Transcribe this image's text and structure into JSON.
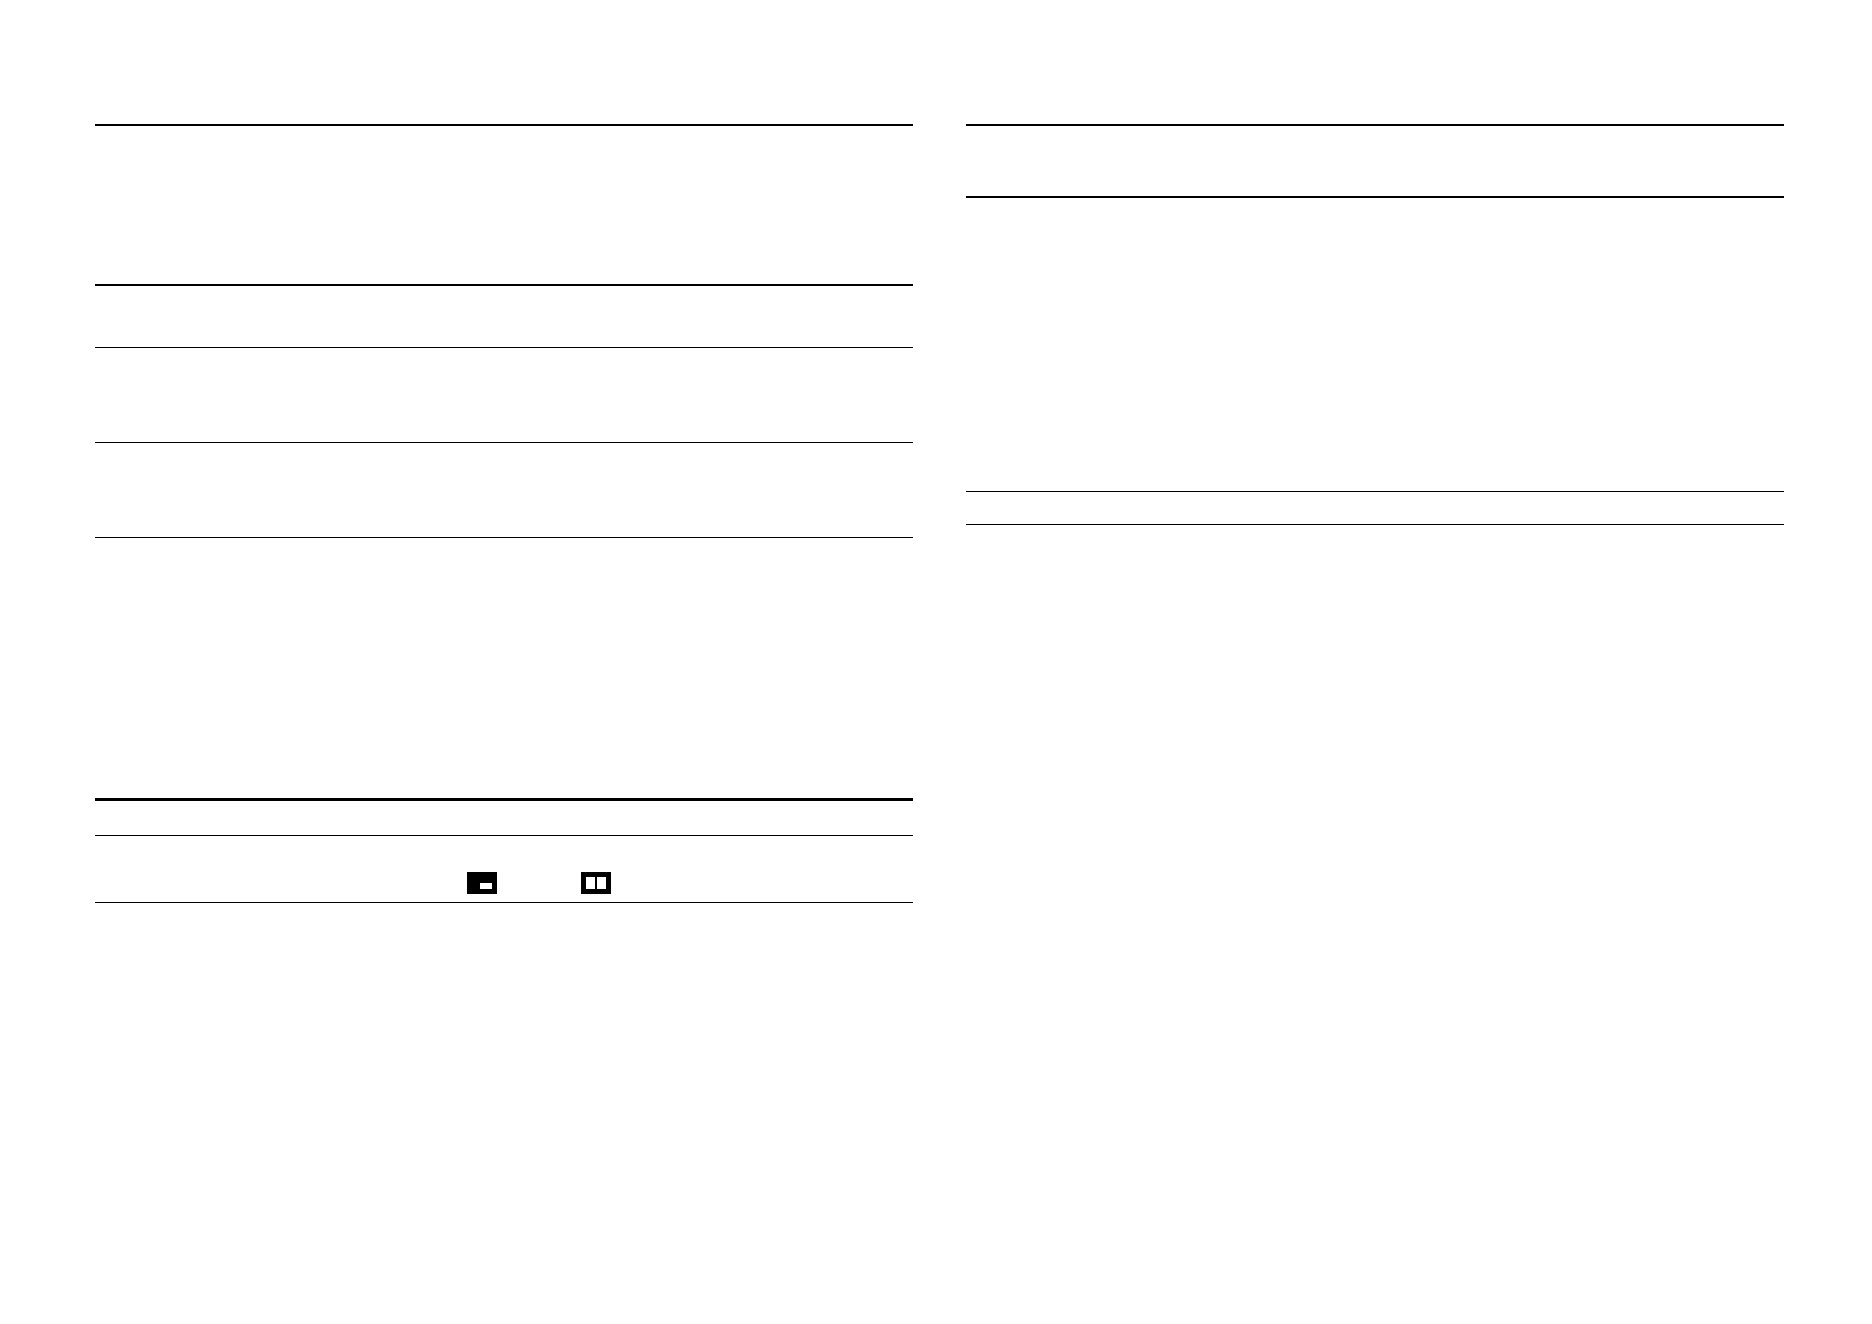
{
  "page": {
    "title": "",
    "left_column": {
      "sections": []
    },
    "right_column": {
      "sections": []
    }
  },
  "icons": {
    "picture_in_picture": "picture-in-picture-icon",
    "side_by_side": "side-by-side-icon"
  },
  "colors": {
    "text": "#000000",
    "background": "#ffffff"
  }
}
